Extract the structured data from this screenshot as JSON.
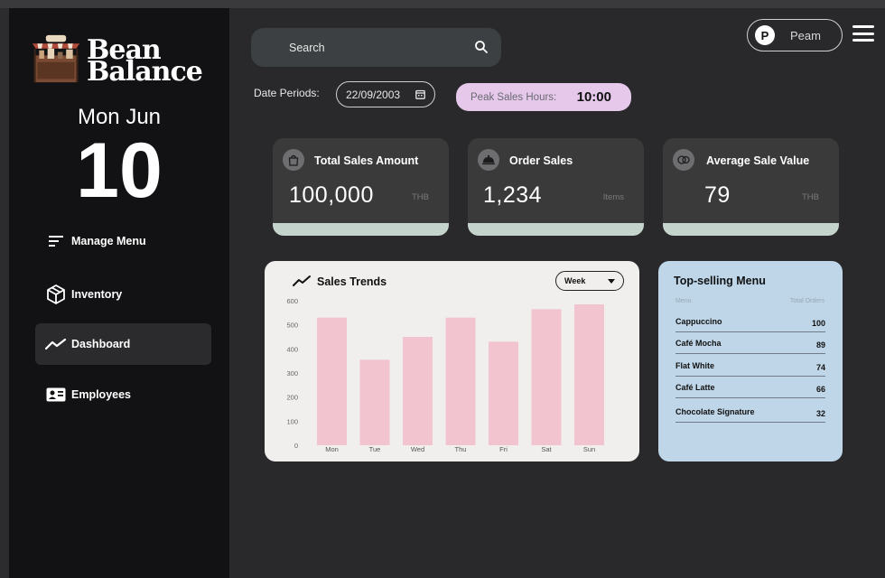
{
  "app": {
    "brand_line1": "Bean",
    "brand_line2": "Balance"
  },
  "date_display": {
    "month_line": "Mon Jun",
    "day": "10"
  },
  "sidebar": {
    "items": [
      {
        "label": "Manage Menu",
        "icon": "filter-lines-icon",
        "active": false
      },
      {
        "label": "Inventory",
        "icon": "box-icon",
        "active": false
      },
      {
        "label": "Dashboard",
        "icon": "trend-line-icon",
        "active": true
      },
      {
        "label": "Employees",
        "icon": "id-card-icon",
        "active": false
      }
    ]
  },
  "header": {
    "search_placeholder": "Search",
    "date_periods_label": "Date Periods:",
    "date_value": "22/09/2003",
    "peak_label": "Peak Sales Hours:",
    "peak_value": "10:00",
    "user_initial": "P",
    "user_name": "Peam"
  },
  "cards": [
    {
      "title": "Total Sales Amount",
      "value": "100,000",
      "unit": "THB",
      "icon": "bag-icon"
    },
    {
      "title": "Order Sales",
      "value": "1,234",
      "unit": "Items",
      "icon": "cloche-icon"
    },
    {
      "title": "Average Sale Value",
      "value": "79",
      "unit": "THB",
      "icon": "coins-icon"
    }
  ],
  "sales_trends": {
    "title": "Sales Trends",
    "period_select": "Week"
  },
  "chart_data": {
    "type": "bar",
    "title": "Sales Trends",
    "categories": [
      "Mon",
      "Tue",
      "Wed",
      "Thu",
      "Fri",
      "Sat",
      "Sun"
    ],
    "values": [
      530,
      355,
      450,
      530,
      430,
      565,
      585
    ],
    "ylim": [
      0,
      600
    ],
    "yticks": [
      0,
      100,
      200,
      300,
      400,
      500,
      600
    ],
    "grid": false,
    "color": "#f2c4cf"
  },
  "top_selling": {
    "title": "Top-selling Menu",
    "col_menu": "Menu",
    "col_orders": "Total Orders",
    "rows": [
      {
        "name": "Cappuccino",
        "orders": "100"
      },
      {
        "name": "Café Mocha",
        "orders": "89"
      },
      {
        "name": "Flat White",
        "orders": "74"
      },
      {
        "name": "Café Latte",
        "orders": "66"
      },
      {
        "name": "Chocolate Signature",
        "orders": "32"
      }
    ]
  },
  "colors": {
    "sidebar_bg": "#121214",
    "main_bg": "#29292b",
    "card_bg": "#3a3a3a",
    "card_strip": "#c4d3cc",
    "peak_bg": "#e5c8ea",
    "bar_color": "#f2c4cf",
    "top_selling_bg": "#bed6e8"
  }
}
